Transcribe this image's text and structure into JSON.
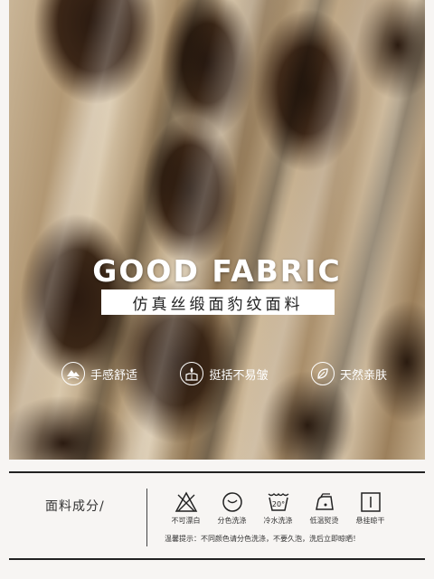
{
  "hero": {
    "title": "GOOD FABRIC",
    "subtitle": "仿真丝缎面豹纹面料",
    "features": [
      {
        "icon": "mountain-hand-icon",
        "label": "手感舒适"
      },
      {
        "icon": "shirt-drop-icon",
        "label": "挺括不易皱"
      },
      {
        "icon": "leaf-icon",
        "label": "天然亲肤"
      }
    ]
  },
  "composition": {
    "label": "面料成分/"
  },
  "care": {
    "items": [
      {
        "icon": "no-bleach-icon",
        "label": "不可漂白"
      },
      {
        "icon": "separate-wash-icon",
        "label": "分色洗涤"
      },
      {
        "icon": "cold-wash-icon",
        "label": "冷水洗涤",
        "temp": "20°"
      },
      {
        "icon": "low-iron-icon",
        "label": "低温熨烫"
      },
      {
        "icon": "hang-dry-icon",
        "label": "悬挂晾干"
      }
    ],
    "note": "温馨提示：不同颜色请分色洗涤，不要久泡，洗后立即晾晒！"
  }
}
